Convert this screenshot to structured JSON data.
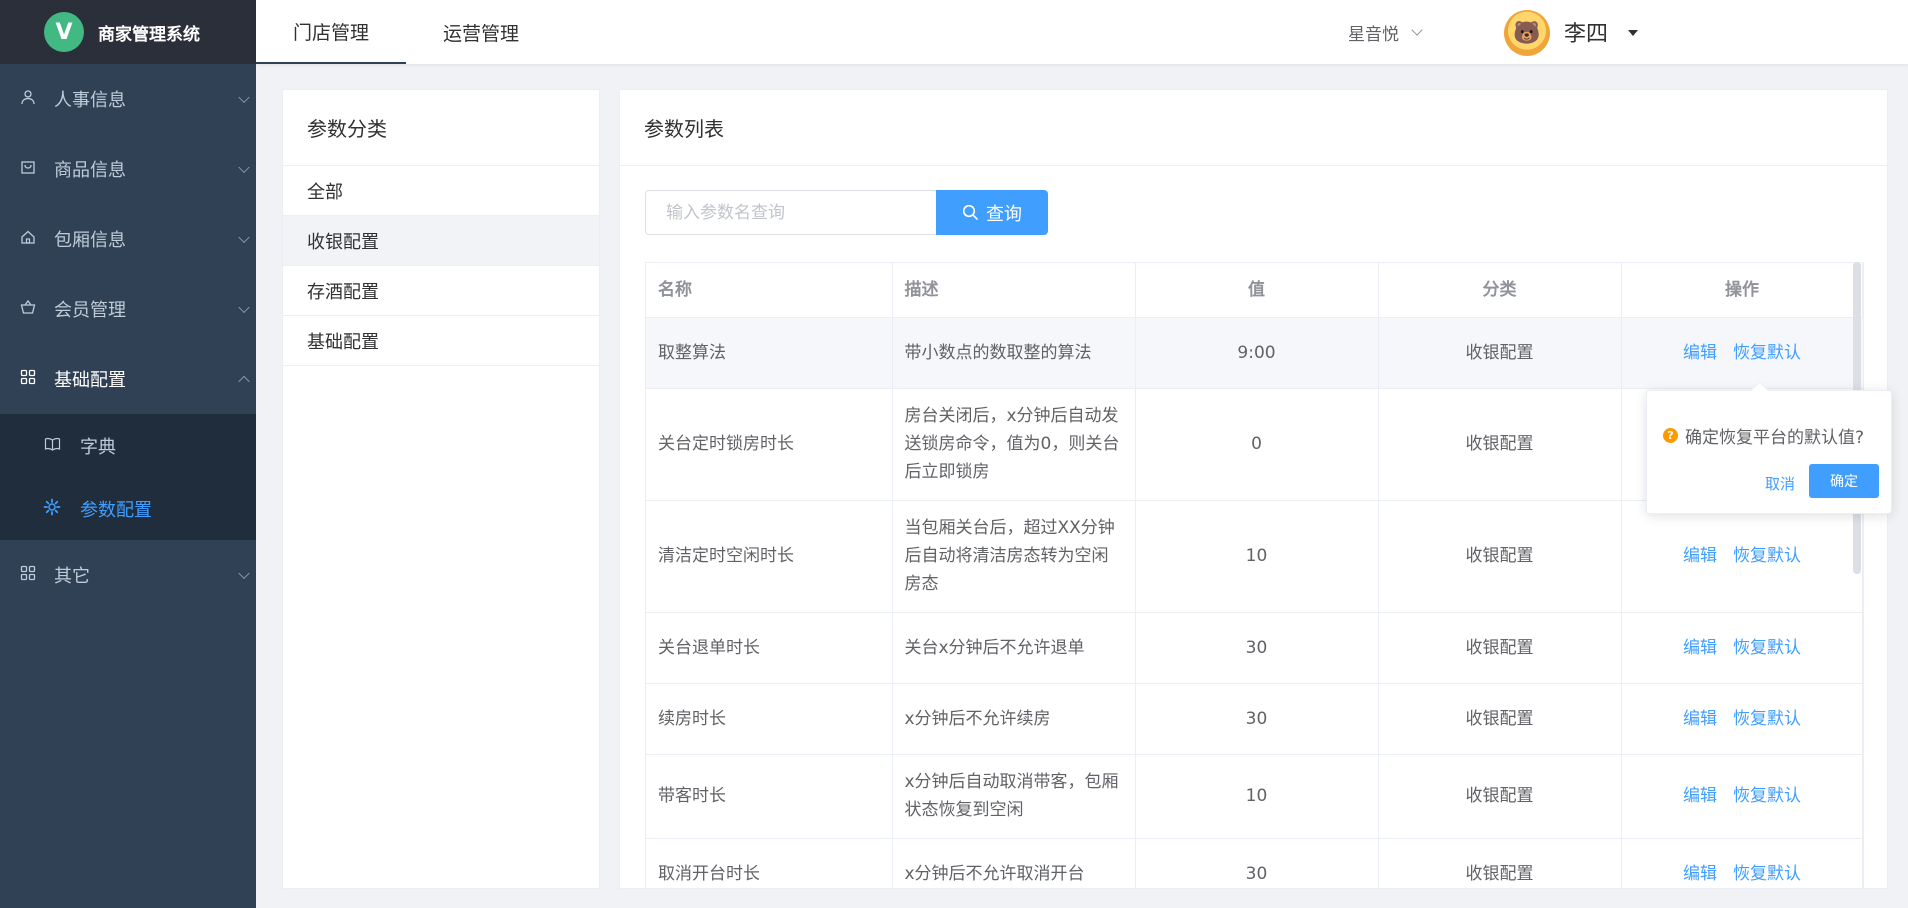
{
  "app": {
    "title": "商家管理系统",
    "logo_letter": "V"
  },
  "sidebar": {
    "items": [
      {
        "label": "人事信息",
        "icon": "user-icon"
      },
      {
        "label": "商品信息",
        "icon": "shopping-bag-icon"
      },
      {
        "label": "包厢信息",
        "icon": "home-icon"
      },
      {
        "label": "会员管理",
        "icon": "basket-icon"
      },
      {
        "label": "基础配置",
        "icon": "grid-icon",
        "expanded": true,
        "children": [
          {
            "label": "字典",
            "icon": "book-icon"
          },
          {
            "label": "参数配置",
            "icon": "gear-icon",
            "active": true
          }
        ]
      },
      {
        "label": "其它",
        "icon": "grid-icon"
      }
    ]
  },
  "header": {
    "tabs": [
      {
        "label": "门店管理",
        "active": true
      },
      {
        "label": "运营管理"
      }
    ],
    "store": "星音悦",
    "user_name": "李四"
  },
  "categories": {
    "title": "参数分类",
    "items": [
      {
        "label": "全部"
      },
      {
        "label": "收银配置",
        "active": true
      },
      {
        "label": "存酒配置"
      },
      {
        "label": "基础配置"
      }
    ]
  },
  "param_list": {
    "title": "参数列表",
    "search": {
      "placeholder": "输入参数名查询",
      "value": "",
      "button": "查询"
    },
    "columns": [
      "名称",
      "描述",
      "值",
      "分类",
      "操作"
    ],
    "rows": [
      {
        "name": "取整算法",
        "desc": "带小数点的数取整的算法",
        "value": "9:00",
        "category": "收银配置"
      },
      {
        "name": "关台定时锁房时长",
        "desc": "房台关闭后，x分钟后自动发送锁房命令，值为0，则关台后立即锁房",
        "value": "0",
        "category": "收银配置"
      },
      {
        "name": "清洁定时空闲时长",
        "desc": "当包厢关台后，超过XX分钟后自动将清洁房态转为空闲房态",
        "value": "10",
        "category": "收银配置"
      },
      {
        "name": "关台退单时长",
        "desc": "关台x分钟后不允许退单",
        "value": "30",
        "category": "收银配置"
      },
      {
        "name": "续房时长",
        "desc": "x分钟后不允许续房",
        "value": "30",
        "category": "收银配置"
      },
      {
        "name": "带客时长",
        "desc": "x分钟后自动取消带客，包厢状态恢复到空闲",
        "value": "10",
        "category": "收银配置"
      },
      {
        "name": "取消开台时长",
        "desc": "x分钟后不允许取消开台",
        "value": "30",
        "category": "收银配置"
      }
    ],
    "row_actions": {
      "edit": "编辑",
      "reset": "恢复默认"
    }
  },
  "popconfirm": {
    "message": "确定恢复平台的默认值?",
    "cancel": "取消",
    "confirm": "确定"
  }
}
